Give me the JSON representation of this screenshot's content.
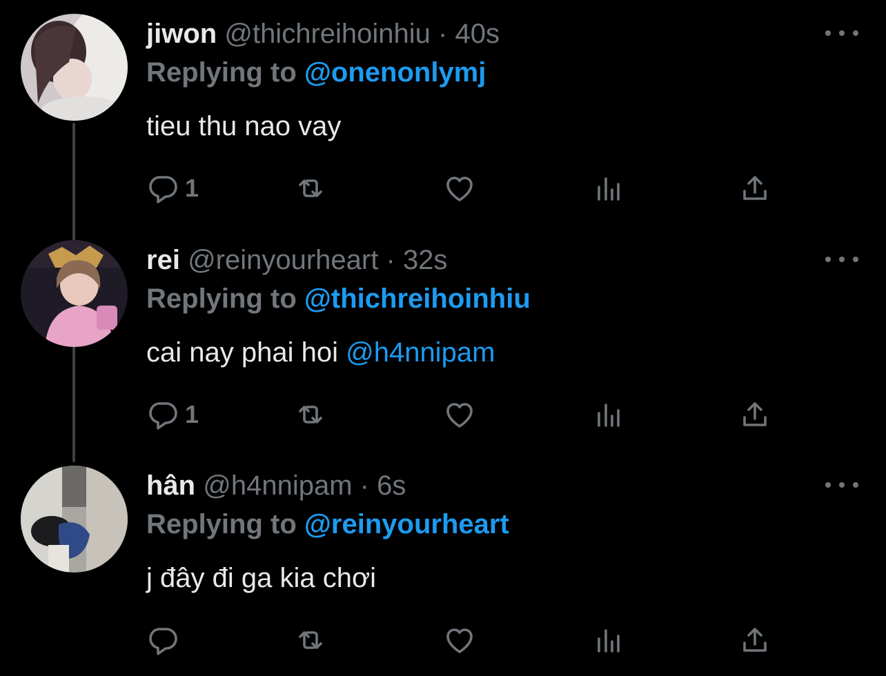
{
  "tweets": [
    {
      "name": "jiwon",
      "handle": "@thichreihoinhiu",
      "separator": "·",
      "time": "40s",
      "replying_prefix": "Replying to",
      "replying_to": "@onenonlymj",
      "text": "tieu thu nao vay",
      "mention": "",
      "reply_count": "1",
      "avatar_colors": [
        "#d9d4d6",
        "#3a2a2c"
      ]
    },
    {
      "name": "rei",
      "handle": "@reinyourheart",
      "separator": "·",
      "time": "32s",
      "replying_prefix": "Replying to",
      "replying_to": "@thichreihoinhiu",
      "text": "cai nay phai hoi ",
      "mention": "@h4nnipam",
      "reply_count": "1",
      "avatar_colors": [
        "#e6a7c9",
        "#1f1a2a"
      ]
    },
    {
      "name": "hân",
      "handle": "@h4nnipam",
      "separator": "·",
      "time": "6s",
      "replying_prefix": "Replying to",
      "replying_to": "@reinyourheart",
      "text": "j đây đi ga kia chơi",
      "mention": "",
      "reply_count": "",
      "avatar_colors": [
        "#b9b7b1",
        "#2c3f6b"
      ]
    }
  ],
  "icons": {
    "reply": "reply-icon",
    "retweet": "retweet-icon",
    "like": "like-icon",
    "views": "views-icon",
    "share": "share-icon",
    "more": "more-icon"
  },
  "colors": {
    "background": "#000000",
    "primary_text": "#e7e9ea",
    "secondary_text": "#71767b",
    "accent": "#1d9bf0",
    "thread_line": "#3e4144"
  }
}
